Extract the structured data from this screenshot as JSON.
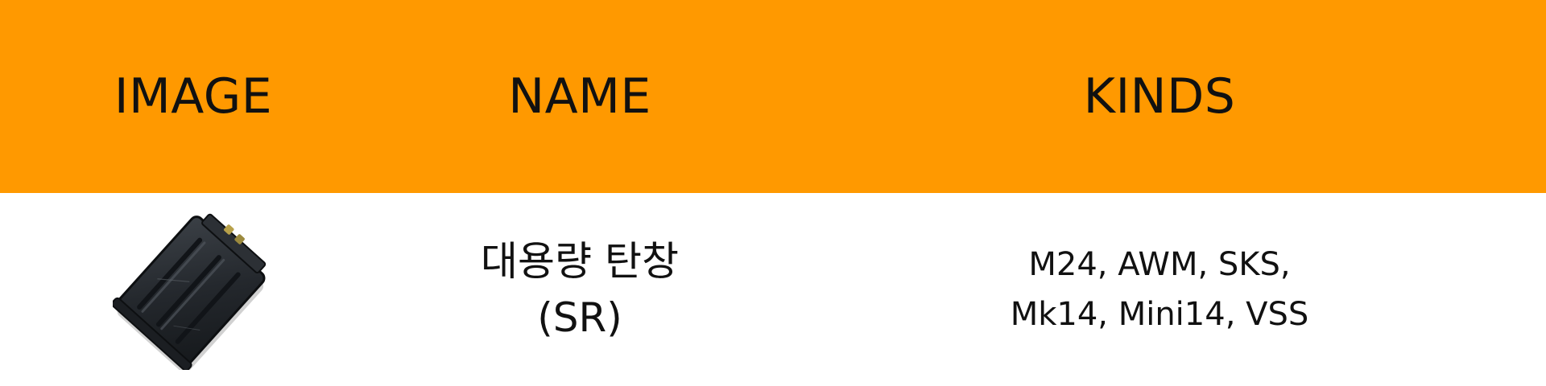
{
  "header": {
    "image_label": "IMAGE",
    "name_label": "NAME",
    "kinds_label": "KINDS"
  },
  "row": {
    "image_icon": "magazine-icon",
    "name": "대용량 탄창\n(SR)",
    "kinds": "M24, AWM, SKS,\nMk14, Mini14, VSS"
  },
  "colors": {
    "header_background": "#ff9900",
    "body_background": "#ffffff",
    "text": "#111111"
  }
}
